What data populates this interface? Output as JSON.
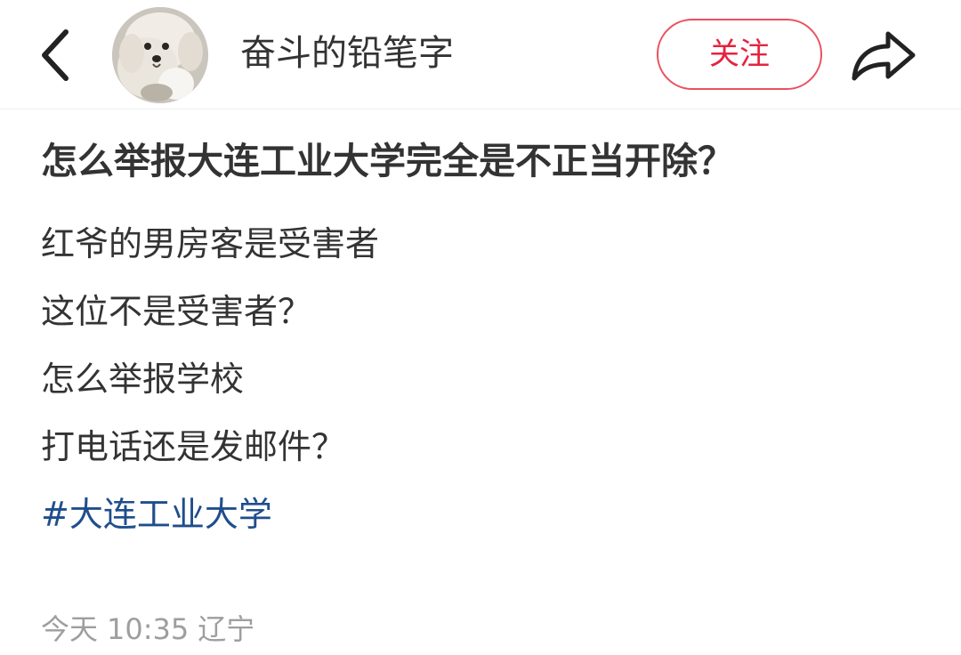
{
  "header": {
    "back_icon": "chevron-left-icon",
    "username": "奋斗的铅笔字",
    "follow_label": "关注",
    "share_icon": "share-arrow-icon",
    "accent_color": "#e5233f"
  },
  "post": {
    "title": "怎么举报大连工业大学完全是不正当开除？",
    "lines": [
      "红爷的男房客是受害者",
      "这位不是受害者？",
      "怎么举报学校",
      "打电话还是发邮件？"
    ],
    "hashtag": "#大连工业大学",
    "hashtag_color": "#1f4e8c"
  },
  "meta": {
    "day": "今天",
    "time": "10:35",
    "location": "辽宁"
  }
}
